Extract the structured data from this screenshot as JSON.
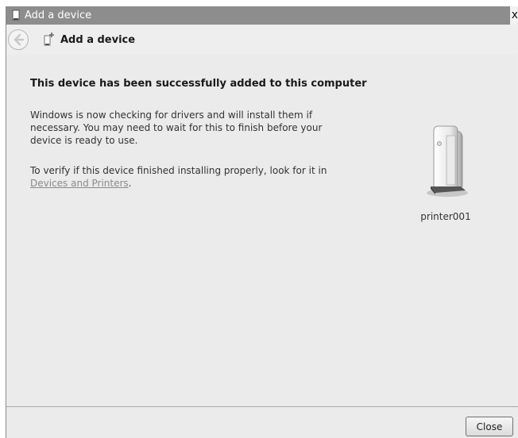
{
  "window": {
    "title": "Add a device",
    "close_glyph": "x"
  },
  "nav": {
    "back_icon": "back-arrow-icon",
    "icon": "add-device-icon",
    "title": "Add a device"
  },
  "content": {
    "headline": "This device has been successfully added to this computer",
    "paragraph1": "Windows is now checking for drivers and will install them if necessary. You may need to wait for this to finish before your device is ready to use.",
    "paragraph2_prefix": "To verify if this device finished installing properly, look for it in ",
    "link_text": "Devices and Printers",
    "paragraph2_suffix": "."
  },
  "device": {
    "icon": "printer-device-icon",
    "label": "printer001"
  },
  "footer": {
    "close_label": "Close"
  },
  "colors": {
    "titlebar": "#8d8d8d",
    "background": "#eeeeee",
    "link": "#8a8a8a"
  }
}
